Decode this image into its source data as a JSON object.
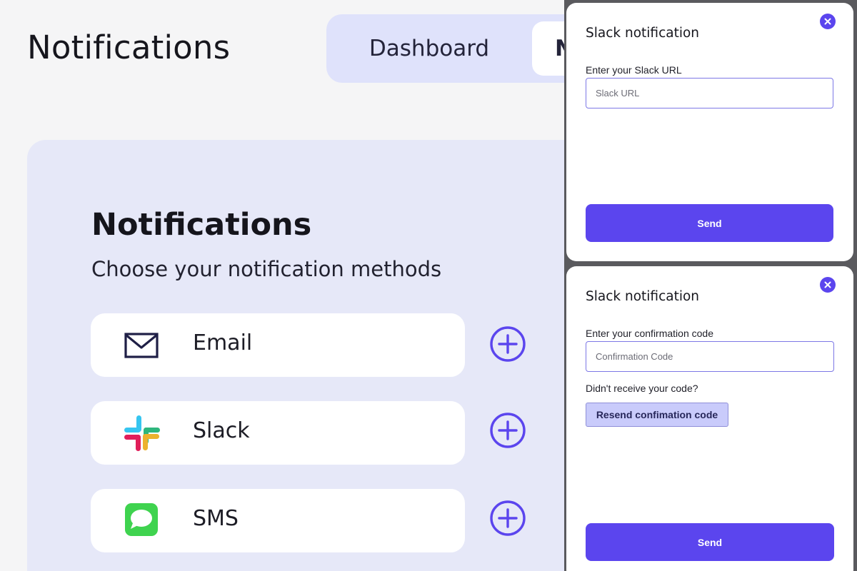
{
  "header": {
    "title": "Notifications",
    "tabs": [
      {
        "label": "Dashboard",
        "active": false
      },
      {
        "label": "N",
        "active": true
      }
    ]
  },
  "panel": {
    "title": "Notifications",
    "subtitle": "Choose your notification methods",
    "methods": [
      {
        "label": "Email",
        "icon": "envelope-icon"
      },
      {
        "label": "Slack",
        "icon": "slack-logo-icon"
      },
      {
        "label": "SMS",
        "icon": "message-bubble-icon"
      }
    ]
  },
  "modal_url": {
    "title": "Slack notification",
    "field_label": "Enter your Slack URL",
    "placeholder": "Slack URL",
    "value": "",
    "send_label": "Send"
  },
  "modal_code": {
    "title": "Slack notification",
    "field_label": "Enter your confirmation code",
    "placeholder": "Confirmation Code",
    "value": "",
    "help_text": "Didn't receive your code?",
    "resend_label": "Resend confimation code",
    "send_label": "Send"
  },
  "colors": {
    "accent": "#5b45ee",
    "panel_bg": "#e6e8f8",
    "tabbar_bg": "#dfe2fb",
    "resend_bg": "#c9cbfb",
    "sms_green": "#3fd34f"
  }
}
